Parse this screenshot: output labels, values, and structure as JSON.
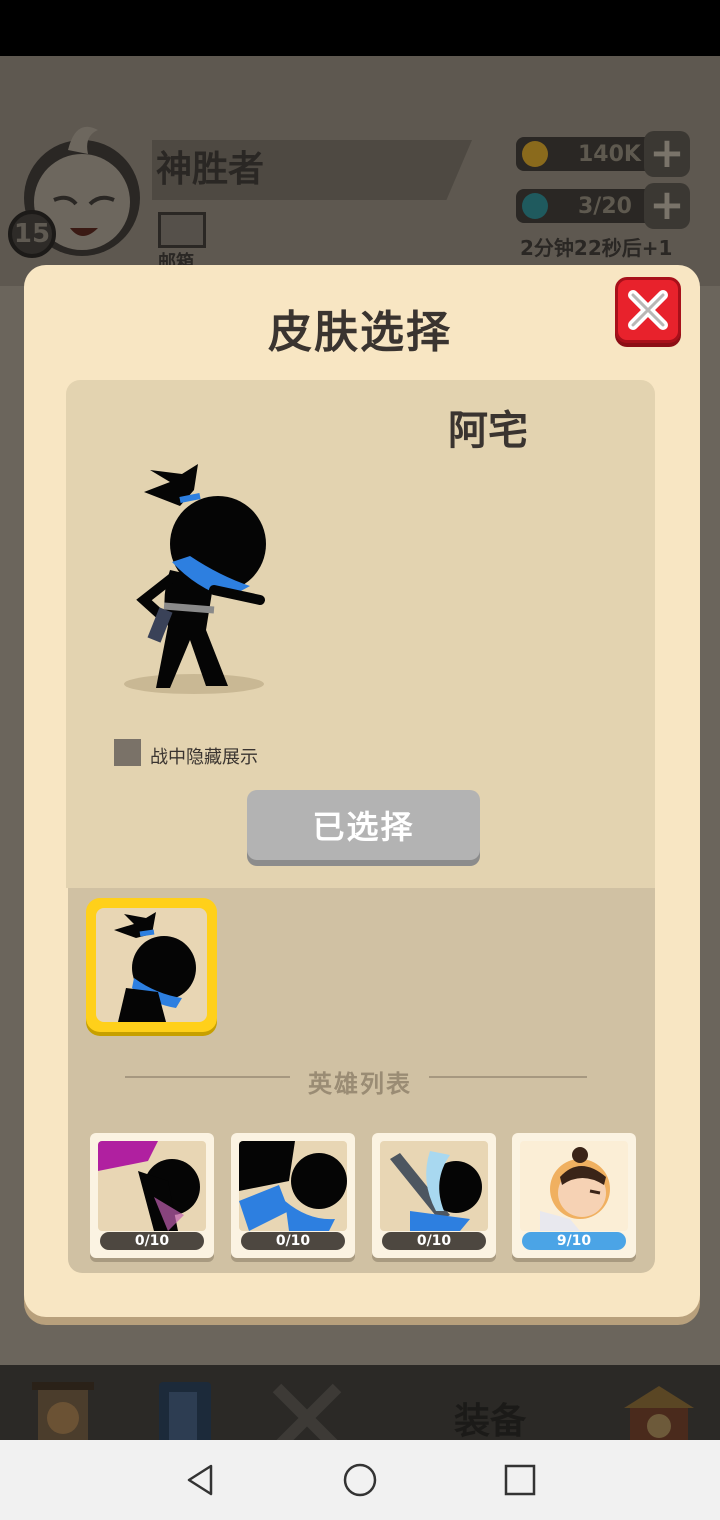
{
  "player": {
    "name": "神胜者",
    "level": "15",
    "mail_label": "邮箱"
  },
  "resources": {
    "gold": "140K",
    "energy": "3/20",
    "timer": "2分钟22秒后+1"
  },
  "bottom_nav": {
    "equip_label": "装备"
  },
  "dialog": {
    "title": "皮肤选择",
    "skin_name": "阿宅",
    "hide_checkbox_label": "战中隐藏展示",
    "select_button_label": "已选择",
    "hero_list_title": "英雄列表"
  },
  "heroes": [
    {
      "progress": "0/10",
      "level": 0.0
    },
    {
      "progress": "0/10",
      "level": 0.0
    },
    {
      "progress": "0/10",
      "level": 0.0
    },
    {
      "progress": "9/10",
      "level": 0.9
    }
  ],
  "colors": {
    "accent": "#ffd01a",
    "close": "#e8222c",
    "progress_fill": "#4ba4e6",
    "panel": "#f8e6c3"
  }
}
